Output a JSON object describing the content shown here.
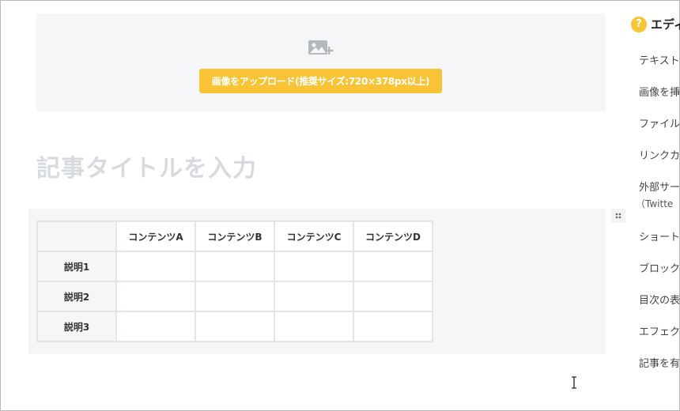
{
  "upload": {
    "icon": "add-image-icon",
    "button_label": "画像をアップロード(推奨サイズ:720×378px以上)"
  },
  "title": {
    "placeholder": "記事タイトルを入力"
  },
  "table": {
    "corner": "",
    "columns": [
      "コンテンツA",
      "コンテンツB",
      "コンテンツC",
      "コンテンツD"
    ],
    "rows": [
      {
        "label": "説明1",
        "cells": [
          "",
          "",
          "",
          ""
        ]
      },
      {
        "label": "説明2",
        "cells": [
          "",
          "",
          "",
          ""
        ]
      },
      {
        "label": "説明3",
        "cells": [
          "",
          "",
          "",
          ""
        ]
      }
    ]
  },
  "help_panel": {
    "icon_glyph": "?",
    "title": "エディ",
    "items": [
      {
        "label": "テキスト"
      },
      {
        "label": "画像を挿"
      },
      {
        "label": "ファイル"
      },
      {
        "label": "リンクカ"
      },
      {
        "label": "外部サー",
        "sub": "（Twitte"
      },
      {
        "label": "ショート"
      },
      {
        "label": "ブロック"
      },
      {
        "label": "目次の表"
      },
      {
        "label": "エフェク"
      },
      {
        "label": "記事を有"
      }
    ]
  },
  "colors": {
    "accent": "#f8c334",
    "block_bg": "#f5f6f8",
    "placeholder_text": "#d7dbe0",
    "table_border": "#e2e5e9"
  }
}
